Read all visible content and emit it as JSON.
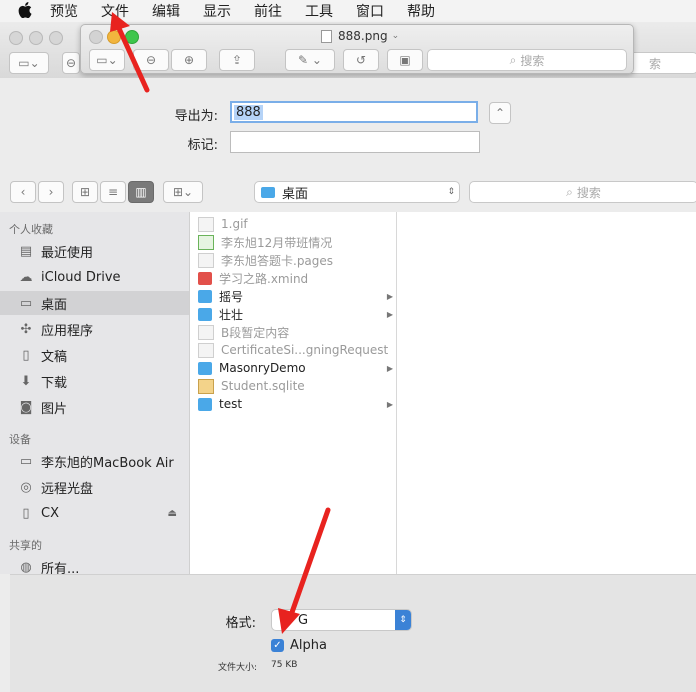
{
  "menubar": {
    "apple": "",
    "items": [
      "预览",
      "文件",
      "编辑",
      "显示",
      "前往",
      "工具",
      "窗口",
      "帮助"
    ]
  },
  "bg_window": {
    "search_placeholder": "索"
  },
  "preview_window": {
    "title": "888.png",
    "search_placeholder": "搜索"
  },
  "export": {
    "save_as_label": "导出为:",
    "save_as_value": "888",
    "tags_label": "标记:",
    "tags_value": ""
  },
  "browser": {
    "location": "桌面",
    "search_placeholder": "搜索"
  },
  "sidebar": {
    "favorites_header": "个人收藏",
    "favorites": [
      {
        "label": "最近使用",
        "icon": "recents-icon"
      },
      {
        "label": "iCloud Drive",
        "icon": "cloud-icon"
      },
      {
        "label": "桌面",
        "icon": "desktop-icon",
        "selected": true
      },
      {
        "label": "应用程序",
        "icon": "applications-icon"
      },
      {
        "label": "文稿",
        "icon": "documents-icon"
      },
      {
        "label": "下载",
        "icon": "downloads-icon"
      },
      {
        "label": "图片",
        "icon": "pictures-icon"
      }
    ],
    "devices_header": "设备",
    "devices": [
      {
        "label": "李东旭的MacBook Air",
        "icon": "laptop-icon"
      },
      {
        "label": "远程光盘",
        "icon": "disc-icon"
      },
      {
        "label": "CX",
        "icon": "drive-icon",
        "eject": "⏏"
      }
    ],
    "shared_header": "共享的",
    "shared": [
      {
        "label": "所有...",
        "icon": "network-icon"
      }
    ]
  },
  "files": [
    {
      "name": "1.gif",
      "type": "file",
      "dim": true
    },
    {
      "name": "李东旭12月带班情况",
      "type": "sheet",
      "dim": true
    },
    {
      "name": "李东旭答题卡.pages",
      "type": "file",
      "dim": true
    },
    {
      "name": "学习之路.xmind",
      "type": "xmind",
      "dim": true
    },
    {
      "name": "摇号",
      "type": "folder",
      "dim": false
    },
    {
      "name": "壮壮",
      "type": "folder",
      "dim": false
    },
    {
      "name": "B段暂定内容",
      "type": "file",
      "dim": true
    },
    {
      "name": "CertificateSi...gningRequest",
      "type": "file",
      "dim": true
    },
    {
      "name": "MasonryDemo",
      "type": "folder",
      "dim": false
    },
    {
      "name": "Student.sqlite",
      "type": "db",
      "dim": true
    },
    {
      "name": "test",
      "type": "folder",
      "dim": false
    }
  ],
  "options": {
    "format_label": "格式:",
    "format_value": "G",
    "alpha_label": "Alpha",
    "alpha_checked": true,
    "filesize_label": "文件大小:",
    "filesize_value": "75 KB"
  },
  "colors": {
    "accent": "#3b82d6",
    "annotation_red": "#e8231f",
    "folder_blue": "#4aa8e8"
  }
}
